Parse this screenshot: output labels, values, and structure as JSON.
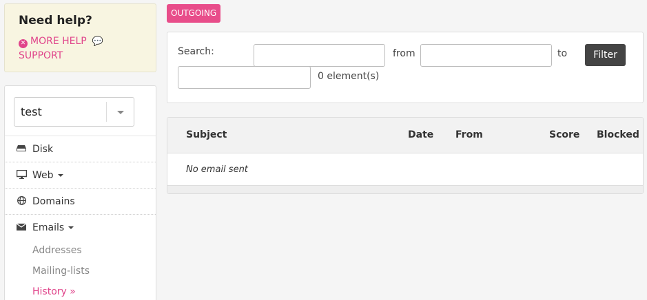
{
  "help": {
    "title": "Need help?",
    "more_help": "MORE HELP",
    "support": "SUPPORT",
    "accent_color": "#e0458b"
  },
  "sidebar": {
    "selected_account": "test",
    "items": [
      {
        "label": "Disk",
        "icon": "disk-icon"
      },
      {
        "label": "Web",
        "icon": "monitor-icon"
      },
      {
        "label": "Domains",
        "icon": "globe-icon"
      },
      {
        "label": "Emails",
        "icon": "envelope-icon"
      }
    ],
    "email_sub": [
      {
        "label": "Addresses"
      },
      {
        "label": "Mailing-lists"
      },
      {
        "label": "History »",
        "active": true
      }
    ]
  },
  "badge": {
    "label": "OUTGOING",
    "color": "#e84d8a"
  },
  "search": {
    "label": "Search:",
    "from_label": "from",
    "to_label": "to",
    "filter_button": "Filter",
    "count": "0 element(s)"
  },
  "table": {
    "columns": [
      "Subject",
      "Date",
      "From",
      "Score",
      "Blocked"
    ],
    "empty_message": "No email sent"
  }
}
